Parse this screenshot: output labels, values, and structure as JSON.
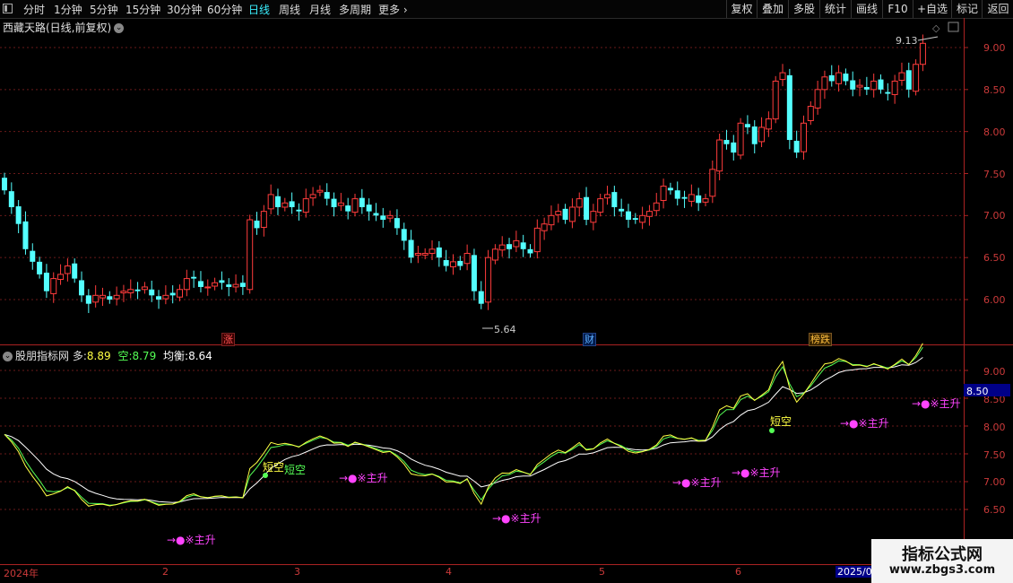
{
  "toolbar": {
    "left": [
      "分时",
      "1分钟",
      "5分钟",
      "15分钟",
      "30分钟",
      "60分钟",
      "日线",
      "周线",
      "月线",
      "多周期",
      "更多"
    ],
    "active": "日线",
    "more_arrow": "›",
    "right": [
      "复权",
      "叠加",
      "多股",
      "统计",
      "画线",
      "F10",
      "+自选",
      "返回"
    ]
  },
  "main_panel": {
    "title": "西藏天路(日线,前复权)",
    "price_axis": [
      "9.00",
      "8.50",
      "8.00",
      "7.50",
      "7.00",
      "6.50",
      "6.00"
    ],
    "high_label": "9.13",
    "low_label": "5.64",
    "tags": [
      "涨",
      "财",
      "榜跌"
    ]
  },
  "indicator_panel": {
    "name": "股朋指标网",
    "duo_label": "多:",
    "duo_value": "8.89",
    "kong_label": "空:",
    "kong_value": "8.79",
    "jh_label": "均衡:",
    "jh_value": "8.64",
    "axis": [
      "9.00",
      "8.50",
      "8.00",
      "7.50",
      "7.00",
      "6.50"
    ],
    "current_value": "8.50",
    "signals": [
      "短空",
      "短空",
      "短空"
    ],
    "zhusheng": "→●※主升"
  },
  "dates": [
    "2024年",
    "2",
    "3",
    "4",
    "5",
    "6",
    "2025/0"
  ],
  "watermark": {
    "line1": "指标公式网",
    "line2": "www.zbgs3.com"
  },
  "colors": {
    "up": "#ff3c3c",
    "down": "#54ffff",
    "line_white": "#ffffff",
    "line_yellow": "#ffff44",
    "line_green": "#55ff55",
    "magenta": "#ff44ff"
  }
}
